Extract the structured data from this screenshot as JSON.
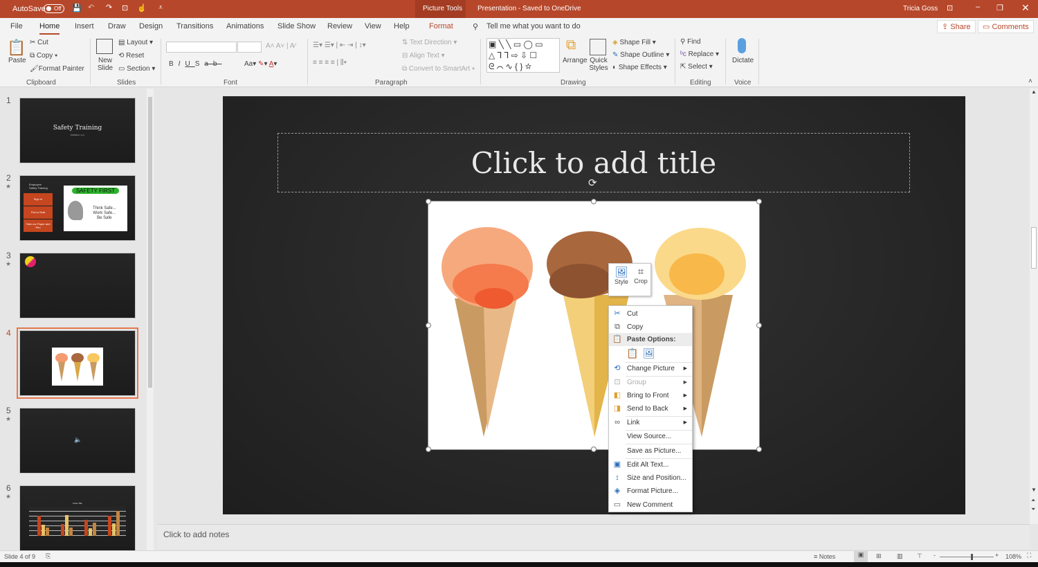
{
  "titlebar": {
    "autosave_label": "AutoSave",
    "autosave_state": "Off",
    "context_tab": "Picture Tools",
    "doc_title": "Presentation - Saved to OneDrive",
    "user": "Tricia Goss",
    "accent": "#b7472a"
  },
  "tabs": [
    "File",
    "Home",
    "Insert",
    "Draw",
    "Design",
    "Transitions",
    "Animations",
    "Slide Show",
    "Review",
    "View",
    "Help",
    "Format"
  ],
  "active_tab": "Home",
  "search_placeholder": "Tell me what you want to do",
  "share": "Share",
  "comments": "Comments",
  "ribbon": {
    "clipboard": {
      "paste": "Paste",
      "cut": "Cut",
      "copy": "Copy",
      "format_painter": "Format Painter",
      "label": "Clipboard"
    },
    "slides": {
      "new_slide": "New Slide",
      "layout": "Layout",
      "reset": "Reset",
      "section": "Section",
      "label": "Slides"
    },
    "font": {
      "bold": "B",
      "italic": "I",
      "underline": "U",
      "shadow": "S",
      "strike": "ab",
      "case": "Aa",
      "label": "Font"
    },
    "paragraph": {
      "text_direction": "Text Direction",
      "align_text": "Align Text",
      "convert": "Convert to SmartArt",
      "label": "Paragraph"
    },
    "drawing": {
      "arrange": "Arrange",
      "quick_styles": "Quick Styles",
      "shape_fill": "Shape Fill",
      "shape_outline": "Shape Outline",
      "shape_effects": "Shape Effects",
      "label": "Drawing"
    },
    "editing": {
      "find": "Find",
      "replace": "Replace",
      "select": "Select",
      "label": "Editing"
    },
    "voice": {
      "dictate": "Dictate",
      "label": "Voice"
    }
  },
  "thumbnails": [
    {
      "num": "1",
      "title": "Safety Training",
      "subtitle": "INSPECK, LLC"
    },
    {
      "num": "2",
      "star": "★",
      "heading": "Employee Safety Training",
      "steps": [
        "Sign In",
        "Find a Seat",
        "Take our Paper and Pen"
      ],
      "banner": "SAFETY FIRST",
      "lines": [
        "Think Safe...",
        "Work Safe...",
        "Be Safe"
      ]
    },
    {
      "num": "3",
      "star": "★"
    },
    {
      "num": "4"
    },
    {
      "num": "5",
      "star": "★"
    },
    {
      "num": "6",
      "star": "★",
      "chart_title": "Chart Title"
    }
  ],
  "slide": {
    "title_placeholder": "Click to add title"
  },
  "mini_toolbar": {
    "style": "Style",
    "crop": "Crop"
  },
  "context_menu": {
    "items": [
      {
        "label": "Cut",
        "icon": "scissors-icon"
      },
      {
        "label": "Copy",
        "icon": "copy-icon"
      },
      {
        "label": "Paste Options:",
        "icon": "paste-icon"
      },
      {
        "label": "Change Picture",
        "icon": "change-picture-icon"
      },
      {
        "label": "Group",
        "icon": "group-icon"
      },
      {
        "label": "Bring to Front",
        "icon": "bring-front-icon"
      },
      {
        "label": "Send to Back",
        "icon": "send-back-icon"
      },
      {
        "label": "Link",
        "icon": "link-icon"
      },
      {
        "label": "View Source..."
      },
      {
        "label": "Save as Picture..."
      },
      {
        "label": "Edit Alt Text...",
        "icon": "alt-text-icon"
      },
      {
        "label": "Size and Position...",
        "icon": "size-icon"
      },
      {
        "label": "Format Picture...",
        "icon": "format-picture-icon"
      },
      {
        "label": "New Comment",
        "icon": "comment-icon"
      }
    ]
  },
  "notes_placeholder": "Click to add notes",
  "status": {
    "slide": "Slide 4 of 9",
    "notes": "Notes",
    "zoom": "108%",
    "zoom_level": 0.58
  }
}
